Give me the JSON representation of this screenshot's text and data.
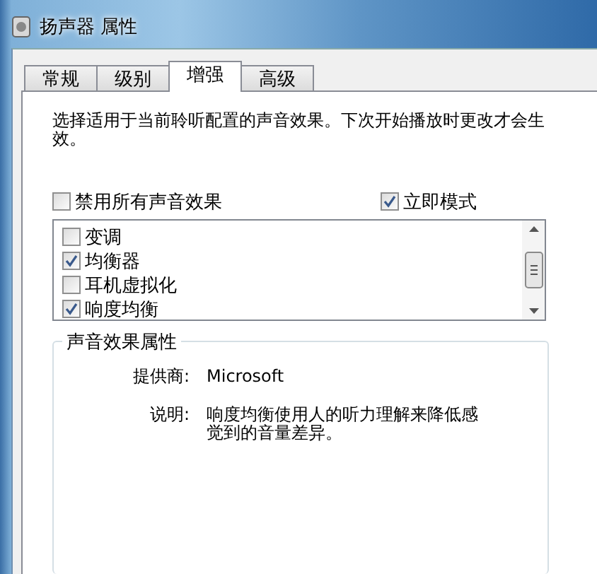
{
  "window": {
    "title": "扬声器 属性"
  },
  "tabs": [
    {
      "label": "常规",
      "selected": false
    },
    {
      "label": "级别",
      "selected": false
    },
    {
      "label": "增强",
      "selected": true
    },
    {
      "label": "高级",
      "selected": false
    }
  ],
  "description": "选择适用于当前聆听配置的声音效果。下次开始播放时更改才会生效。",
  "options": [
    {
      "label": "禁用所有声音效果",
      "checked": false
    },
    {
      "label": "立即模式",
      "checked": true
    }
  ],
  "effects": [
    {
      "label": "变调",
      "checked": false
    },
    {
      "label": "均衡器",
      "checked": true
    },
    {
      "label": "耳机虚拟化",
      "checked": false
    },
    {
      "label": "响度均衡",
      "checked": true
    }
  ],
  "properties_group": {
    "title": "声音效果属性",
    "rows": [
      {
        "label": "提供商:",
        "value": "Microsoft"
      },
      {
        "label": "说明:",
        "value": "响度均衡使用人的听力理解来降低感觉到的音量差异。"
      }
    ]
  }
}
